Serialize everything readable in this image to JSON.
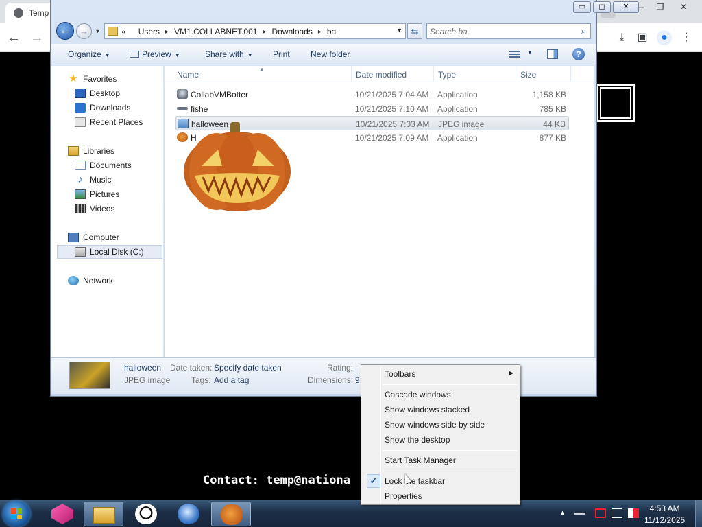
{
  "browser": {
    "tab_title": "Temp",
    "new_tab_icon": "plus-icon",
    "window_controls": [
      "—",
      "❐",
      "✕"
    ],
    "nav_icons": [
      "back-arrow-icon",
      "forward-arrow-icon"
    ],
    "toolbar_icons": [
      "download-icon",
      "sidebar-icon",
      "profile-icon",
      "more-icon"
    ]
  },
  "desktop": {
    "contact_text": "Contact: temp@nationa"
  },
  "explorer": {
    "breadcrumbs": [
      "Users",
      "VM1.COLLABNET.001",
      "Downloads",
      "ba"
    ],
    "breadcrumb_prefix": "«",
    "search_placeholder": "Search ba",
    "caption_buttons": [
      "▭",
      "◻",
      "✕"
    ],
    "commands": {
      "organize": "Organize",
      "preview": "Preview",
      "share_with": "Share with",
      "print": "Print",
      "new_folder": "New folder"
    },
    "nav_pane": [
      {
        "label": "Favorites",
        "icon": "star-icon"
      },
      {
        "label": "Desktop",
        "icon": "desktop-icon"
      },
      {
        "label": "Downloads",
        "icon": "downloads-icon"
      },
      {
        "label": "Recent Places",
        "icon": "recent-places-icon"
      },
      {
        "label": "Libraries",
        "icon": "libraries-icon"
      },
      {
        "label": "Documents",
        "icon": "documents-icon"
      },
      {
        "label": "Music",
        "icon": "music-icon"
      },
      {
        "label": "Pictures",
        "icon": "pictures-icon"
      },
      {
        "label": "Videos",
        "icon": "videos-icon"
      },
      {
        "label": "Computer",
        "icon": "computer-icon"
      },
      {
        "label": "Local Disk (C:)",
        "icon": "disk-icon"
      },
      {
        "label": "Network",
        "icon": "network-icon"
      }
    ],
    "columns": [
      "Name",
      "Date modified",
      "Type",
      "Size"
    ],
    "files": [
      {
        "name": "CollabVMBotter",
        "date": "10/21/2025 7:04 AM",
        "type": "Application",
        "size": "1,158 KB",
        "icon": "app-icon"
      },
      {
        "name": "fishe",
        "date": "10/21/2025 7:10 AM",
        "type": "Application",
        "size": "785 KB",
        "icon": "app-icon"
      },
      {
        "name": "halloween",
        "date": "10/21/2025 7:03 AM",
        "type": "JPEG image",
        "size": "44 KB",
        "icon": "jpeg-icon"
      },
      {
        "name": "H",
        "date": "10/21/2025 7:09 AM",
        "type": "Application",
        "size": "877 KB",
        "icon": "pumpkin-icon"
      }
    ],
    "details": {
      "name": "halloween",
      "type": "JPEG image",
      "date_taken_label": "Date taken:",
      "date_taken_value": "Specify date taken",
      "tags_label": "Tags:",
      "tags_value": "Add a tag",
      "rating_label": "Rating:",
      "dimensions_label": "Dimensions:",
      "dimensions_value": "9"
    }
  },
  "context_menu": {
    "toolbars": "Toolbars",
    "cascade": "Cascade windows",
    "stacked": "Show windows stacked",
    "side_by_side": "Show windows side by side",
    "show_desktop": "Show the desktop",
    "task_manager": "Start Task Manager",
    "lock_taskbar": "Lock the taskbar",
    "lock_checked": "✓",
    "properties": "Properties"
  },
  "taskbar": {
    "time": "4:53 AM",
    "date": "11/12/2025",
    "tray_up": "▲"
  }
}
